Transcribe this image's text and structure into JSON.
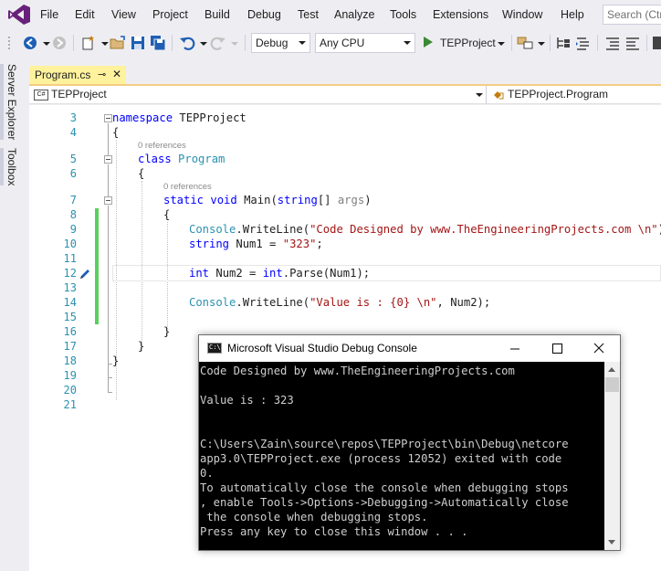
{
  "app": {
    "menu": [
      "File",
      "Edit",
      "View",
      "Project",
      "Build",
      "Debug",
      "Test",
      "Analyze",
      "Tools",
      "Extensions",
      "Window",
      "Help"
    ],
    "search_placeholder": "Search (Ctrl+Q)"
  },
  "toolbar": {
    "configuration": "Debug",
    "platform": "Any CPU",
    "run_target": "TEPProject"
  },
  "side_tabs": [
    "Server Explorer",
    "Toolbox"
  ],
  "document_tab": {
    "label": "Program.cs",
    "pin_glyph": "⊸",
    "close_glyph": "✕"
  },
  "navbar": {
    "project": "TEPProject",
    "class": "TEPProject.Program",
    "cs_icon_text": "C#"
  },
  "editor": {
    "line_numbers": [
      "3",
      "4",
      "5",
      "6",
      "7",
      "8",
      "9",
      "10",
      "11",
      "12",
      "13",
      "14",
      "15",
      "16",
      "17",
      "18",
      "19",
      "20",
      "21"
    ],
    "references_label": "0 references",
    "lines": {
      "l3": {
        "kw": "namespace",
        "rest": " TEPProject"
      },
      "l4": "{",
      "l5": {
        "kw": "class",
        "name": "Program"
      },
      "l6": "{",
      "l7": {
        "kw1": "static",
        "kw2": "void",
        "name": "Main",
        "p1": "(",
        "kw3": "string",
        "p2": "[] ",
        "arg": "args",
        "p3": ")"
      },
      "l8": "{",
      "l9": {
        "type": "Console",
        "rest1": ".WriteLine(",
        "str": "\"Code Designed by www.TheEngineeringProjects.com \\n\"",
        "rest2": ");"
      },
      "l10": {
        "kw": "string",
        "rest1": " Num1 = ",
        "str": "\"323\"",
        "rest2": ";"
      },
      "l12": {
        "kw": "int",
        "rest1": " Num2 = ",
        "kw2": "int",
        "rest2": ".Parse(Num1);"
      },
      "l14": {
        "type": "Console",
        "rest1": ".WriteLine(",
        "str": "\"Value is : {0} \\n\"",
        "rest2": ", Num2);"
      },
      "l16": "}",
      "l17": "}",
      "l18": "}"
    }
  },
  "console": {
    "title": "Microsoft Visual Studio Debug Console",
    "icon_text": "C:\\",
    "lines": [
      "Code Designed by www.TheEngineeringProjects.com",
      "",
      "Value is : 323",
      "",
      "",
      "C:\\Users\\Zain\\source\\repos\\TEPProject\\bin\\Debug\\netcore",
      "app3.0\\TEPProject.exe (process 12052) exited with code",
      "0.",
      "To automatically close the console when debugging stops",
      ", enable Tools->Options->Debugging->Automatically close",
      " the console when debugging stops.",
      "Press any key to close this window . . ."
    ]
  },
  "colors": {
    "keyword": "#0000ff",
    "type": "#2b91af",
    "string": "#a31515",
    "change_bar": "#57d05c",
    "tab_active": "#fff29d"
  }
}
